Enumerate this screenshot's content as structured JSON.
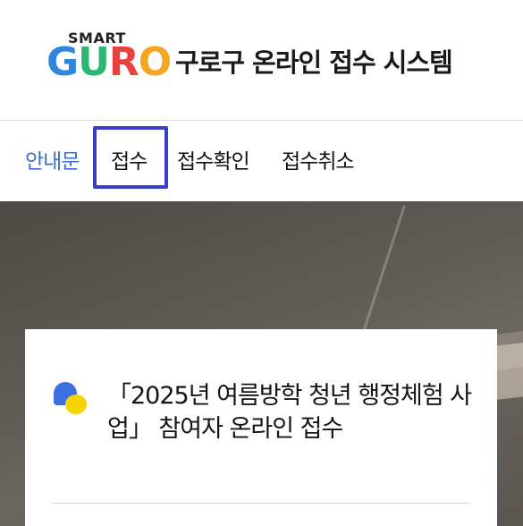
{
  "header": {
    "logo_smart": "SMART",
    "logo_letters": [
      "G",
      "U",
      "R",
      "O"
    ],
    "title": "구로구 온라인 접수 시스템"
  },
  "nav": {
    "items": [
      {
        "label": "안내문",
        "active": true
      },
      {
        "label": "접수",
        "highlighted": true
      },
      {
        "label": "접수확인"
      },
      {
        "label": "접수취소"
      }
    ]
  },
  "card": {
    "title": "「2025년 여름방학 청년 행정체험 사업」 참여자 온라인 접수"
  },
  "colors": {
    "nav_active": "#3a6fc4",
    "highlight_border": "#3a3fc8",
    "icon_blue": "#3d6fe0",
    "icon_yellow": "#f6d400"
  }
}
